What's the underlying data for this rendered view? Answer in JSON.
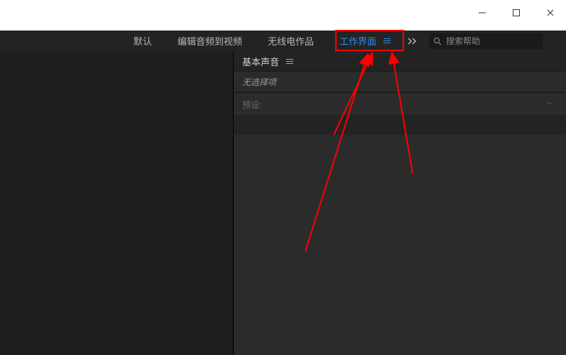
{
  "titlebar": {
    "minimize": "—",
    "maximize": "□",
    "close": "✕"
  },
  "tabs": {
    "default": "默认",
    "edit_audio": "编辑音频到视频",
    "radio": "无线电作品",
    "workspace": "工作界面"
  },
  "search": {
    "placeholder": "搜索帮助"
  },
  "panel": {
    "title": "基本声音",
    "no_selection": "无选择项",
    "preset_label": "预设:"
  }
}
